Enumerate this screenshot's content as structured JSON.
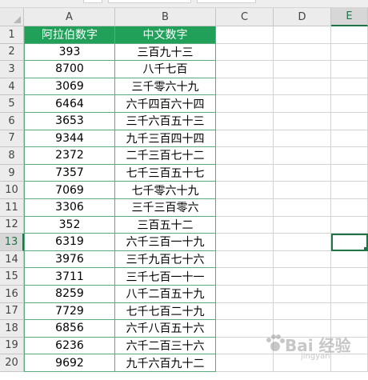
{
  "columns": [
    "A",
    "B",
    "C",
    "D",
    "E"
  ],
  "rows": [
    "1",
    "2",
    "3",
    "4",
    "5",
    "6",
    "7",
    "8",
    "9",
    "10",
    "11",
    "12",
    "13",
    "14",
    "15",
    "16",
    "17",
    "18",
    "19",
    "20"
  ],
  "active_column": "E",
  "active_row": "13",
  "table": {
    "headers": [
      "阿拉伯数字",
      "中文数字"
    ],
    "rows": [
      [
        "393",
        "三百九十三"
      ],
      [
        "8700",
        "八千七百"
      ],
      [
        "3069",
        "三千零六十九"
      ],
      [
        "6464",
        "六千四百六十四"
      ],
      [
        "3653",
        "三千六百五十三"
      ],
      [
        "9344",
        "九千三百四十四"
      ],
      [
        "2372",
        "二千三百七十二"
      ],
      [
        "7357",
        "七千三百五十七"
      ],
      [
        "7069",
        "七千零六十九"
      ],
      [
        "3306",
        "三千三百零六"
      ],
      [
        "352",
        "三百五十二"
      ],
      [
        "6319",
        "六千三百一十九"
      ],
      [
        "3976",
        "三千九百七十六"
      ],
      [
        "3711",
        "三千七百一十一"
      ],
      [
        "8259",
        "八千二百五十九"
      ],
      [
        "7729",
        "七千七百二十九"
      ],
      [
        "6856",
        "六千八百五十六"
      ],
      [
        "6236",
        "六千二百三十六"
      ],
      [
        "9692",
        "九千六百九十二"
      ]
    ]
  },
  "colors": {
    "header_fill": "#21a05a",
    "header_text": "#ffffff",
    "table_border": "#5cab7d",
    "selection": "#217346"
  },
  "watermark": {
    "text": "Bai 经验",
    "sub": "jingyan"
  }
}
